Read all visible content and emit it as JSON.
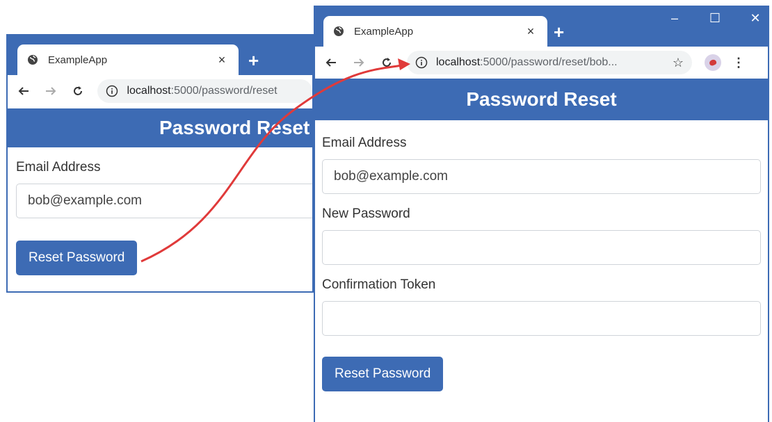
{
  "left_window": {
    "tab": {
      "title": "ExampleApp",
      "close": "×",
      "new_tab": "+"
    },
    "address_bar": {
      "host": "localhost",
      "path": ":5000/password/reset"
    },
    "header": {
      "title": "Password Reset"
    },
    "form": {
      "email_label": "Email Address",
      "email_value": "bob@example.com",
      "submit_label": "Reset Password"
    }
  },
  "right_window": {
    "tab": {
      "title": "ExampleApp",
      "close": "×",
      "new_tab": "+"
    },
    "window_controls": {
      "minimize": "–",
      "maximize": "☐",
      "close": "✕"
    },
    "address_bar": {
      "host": "localhost",
      "path": ":5000/password/reset/bob...",
      "star": "☆"
    },
    "menu": "⋮",
    "header": {
      "title": "Password Reset"
    },
    "form": {
      "email_label": "Email Address",
      "email_value": "bob@example.com",
      "password_label": "New Password",
      "password_value": "",
      "token_label": "Confirmation Token",
      "token_value": "",
      "submit_label": "Reset Password"
    }
  },
  "colors": {
    "brand": "#3d6bb4",
    "arrow": "#e03a3a"
  }
}
